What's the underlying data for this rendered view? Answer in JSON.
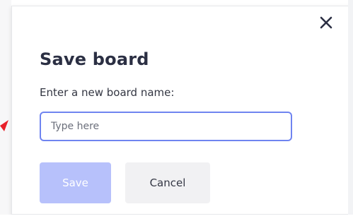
{
  "dialog": {
    "title": "Save board",
    "label": "Enter a new board name:",
    "input_placeholder": "Type here",
    "input_value": "",
    "save_label": "Save",
    "cancel_label": "Cancel",
    "close_icon": "close-icon"
  },
  "colors": {
    "primary_disabled": "#b7c1fb",
    "focus_border": "#6f84f0",
    "title": "#2b2f43",
    "cancel_bg": "#f1f1f3",
    "annotation_arrow": "#e8202a"
  }
}
